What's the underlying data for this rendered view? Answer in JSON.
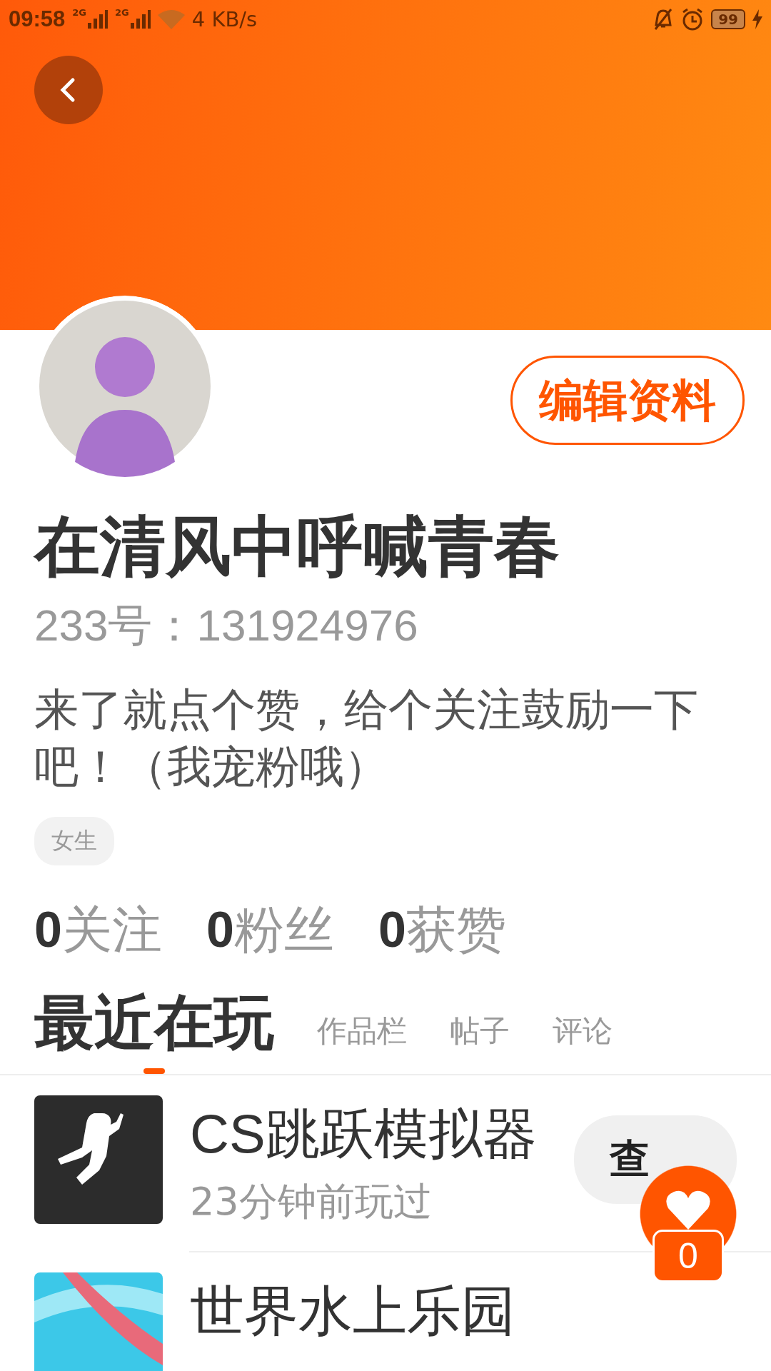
{
  "status_bar": {
    "time": "09:58",
    "network_1": "2G",
    "network_2": "2G",
    "speed": "4 KB/s",
    "battery": "99"
  },
  "profile": {
    "edit_button": "编辑资料",
    "name": "在清风中呼喊青春",
    "id_line": "233号：131924976",
    "bio": "来了就点个赞，给个关注鼓励一下吧！（我宠粉哦）",
    "tags": [
      "女生"
    ]
  },
  "stats": [
    {
      "count": "0",
      "label": "关注"
    },
    {
      "count": "0",
      "label": "粉丝"
    },
    {
      "count": "0",
      "label": "获赞"
    }
  ],
  "tabs": [
    {
      "label": "最近在玩",
      "selected": true
    },
    {
      "label": "作品栏",
      "selected": false
    },
    {
      "label": "帖子",
      "selected": false
    },
    {
      "label": "评论",
      "selected": false
    }
  ],
  "games": [
    {
      "title": "CS跳跃模拟器",
      "subtitle": "23分钟前玩过",
      "button": "查",
      "kind": "runner"
    },
    {
      "title": "世界水上乐园",
      "kind": "picture"
    }
  ],
  "like_fab": {
    "count": "0"
  }
}
